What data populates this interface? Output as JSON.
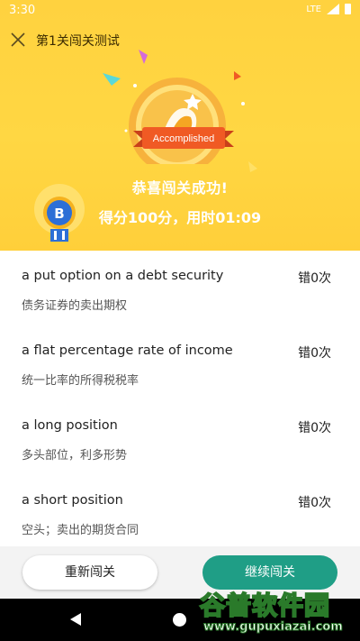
{
  "status_bar": {
    "time": "3:30",
    "network": "LTE"
  },
  "header": {
    "title": "第1关闯关测试"
  },
  "result": {
    "medal_label": "Accomplished",
    "congrats": "恭喜闯关成功!",
    "score_text": "得分100分，用时01:09",
    "badge_letter": "B"
  },
  "items": [
    {
      "term": "a put option on a debt security",
      "meaning": "债务证券的卖出期权",
      "errors": "错0次"
    },
    {
      "term": "a flat percentage rate of income",
      "meaning": "统一比率的所得税税率",
      "errors": "错0次"
    },
    {
      "term": "a long position",
      "meaning": "多头部位，利多形势",
      "errors": "错0次"
    },
    {
      "term": "a short position",
      "meaning": "空头；卖出的期货合同",
      "errors": "错0次"
    }
  ],
  "actions": {
    "retry_label": "重新闯关",
    "continue_label": "继续闯关"
  },
  "watermark": {
    "brand": "谷普软件园",
    "url": "www.gupuxiazai.com"
  },
  "colors": {
    "header_bg": "#ffd23f",
    "accent": "#1f9e86",
    "ribbon": "#f05a24"
  }
}
